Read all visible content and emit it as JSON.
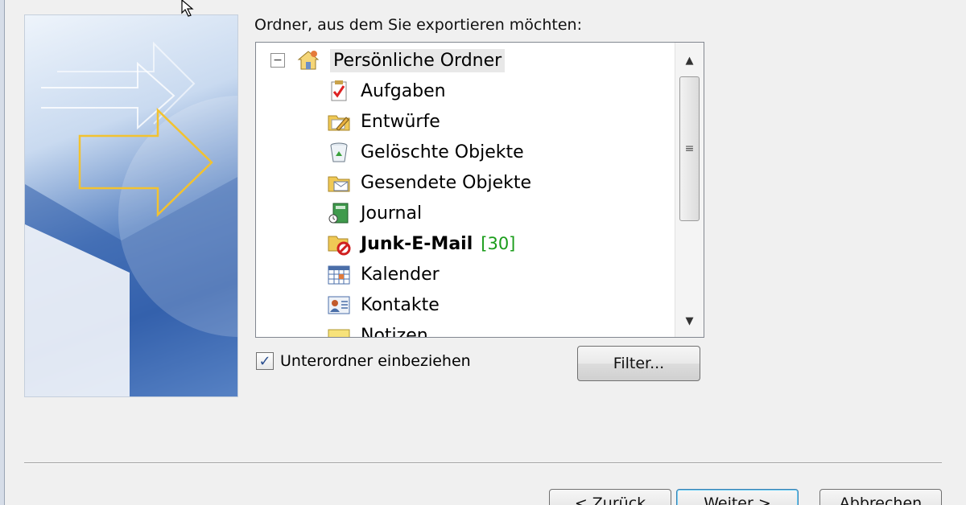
{
  "dialog": {
    "folder_caption": "Ordner, aus dem Sie exportieren möchten:",
    "tree": {
      "root": {
        "label": "Persönliche Ordner",
        "icon": "personal-folders-icon"
      },
      "items": [
        {
          "label": "Aufgaben",
          "icon": "tasks-icon"
        },
        {
          "label": "Entwürfe",
          "icon": "drafts-icon"
        },
        {
          "label": "Gelöschte Objekte",
          "icon": "deleted-items-icon"
        },
        {
          "label": "Gesendete Objekte",
          "icon": "sent-items-icon"
        },
        {
          "label": "Journal",
          "icon": "journal-icon"
        },
        {
          "label": "Junk-E-Mail",
          "icon": "junk-mail-icon",
          "count": "[30]",
          "bold": true
        },
        {
          "label": "Kalender",
          "icon": "calendar-icon"
        },
        {
          "label": "Kontakte",
          "icon": "contacts-icon"
        },
        {
          "label": "Notizen",
          "icon": "notes-icon"
        }
      ]
    },
    "include_subfolders": {
      "label": "Unterordner einbeziehen",
      "checked": true
    },
    "filter_button": "Filter...",
    "buttons": {
      "back": "< Zurück",
      "next": "Weiter >",
      "cancel": "Abbrechen"
    }
  },
  "colors": {
    "unread_count": "#1a9c1a",
    "dialog_background": "#f0f0f0",
    "banner_blue": "#3a66b0",
    "banner_arrow": "#f2c230"
  }
}
